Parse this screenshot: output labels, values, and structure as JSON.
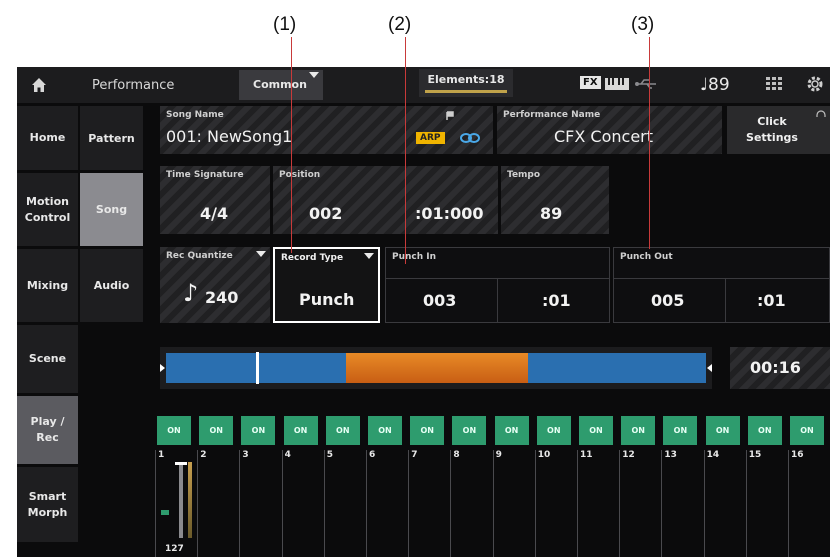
{
  "callouts": [
    "(1)",
    "(2)",
    "(3)"
  ],
  "header": {
    "title": "Performance",
    "tab_common": "Common",
    "elements": "Elements:18",
    "fx": "FX",
    "tempo": "♩89",
    "icons": [
      "home-icon",
      "keyboard-icon",
      "usb-icon",
      "grid-icon",
      "gear-icon"
    ]
  },
  "sidebar": {
    "items": [
      {
        "label": "Home"
      },
      {
        "label": "Motion Control"
      },
      {
        "label": "Mixing"
      },
      {
        "label": "Scene"
      },
      {
        "label": "Play / Rec"
      },
      {
        "label": "Smart Morph"
      }
    ]
  },
  "subtabs": [
    {
      "label": "Pattern"
    },
    {
      "label": "Song"
    },
    {
      "label": "Audio"
    }
  ],
  "song": {
    "song_name_label": "Song Name",
    "song_name": "001: NewSong1",
    "arp": "ARP",
    "performance_name_label": "Performance Name",
    "performance_name": "CFX Concert",
    "click_settings": "Click Settings"
  },
  "row2": {
    "time_signature_label": "Time Signature",
    "time_signature": "4/4",
    "position_label": "Position",
    "position_measure": "002",
    "position_beat": ":01:000",
    "tempo_label": "Tempo",
    "tempo": "89"
  },
  "row3": {
    "rec_quantize_label": "Rec Quantize",
    "rec_quantize": "240",
    "record_type_label": "Record Type",
    "record_type": "Punch",
    "punch_in_label": "Punch In",
    "punch_in_measure": "003",
    "punch_in_beat": ":01",
    "punch_out_label": "Punch Out",
    "punch_out_measure": "005",
    "punch_out_beat": ":01"
  },
  "timeline": {
    "time": "00:16"
  },
  "tracks": {
    "on_label": "ON",
    "numbers": [
      "1",
      "2",
      "3",
      "4",
      "5",
      "6",
      "7",
      "8",
      "9",
      "10",
      "11",
      "12",
      "13",
      "14",
      "15",
      "16"
    ],
    "volume": "127"
  },
  "colors": {
    "accent": "#2e9c6e",
    "timeline_blue": "#2a6fb0",
    "timeline_orange": "#e07a1e",
    "arp": "#f0b400"
  }
}
